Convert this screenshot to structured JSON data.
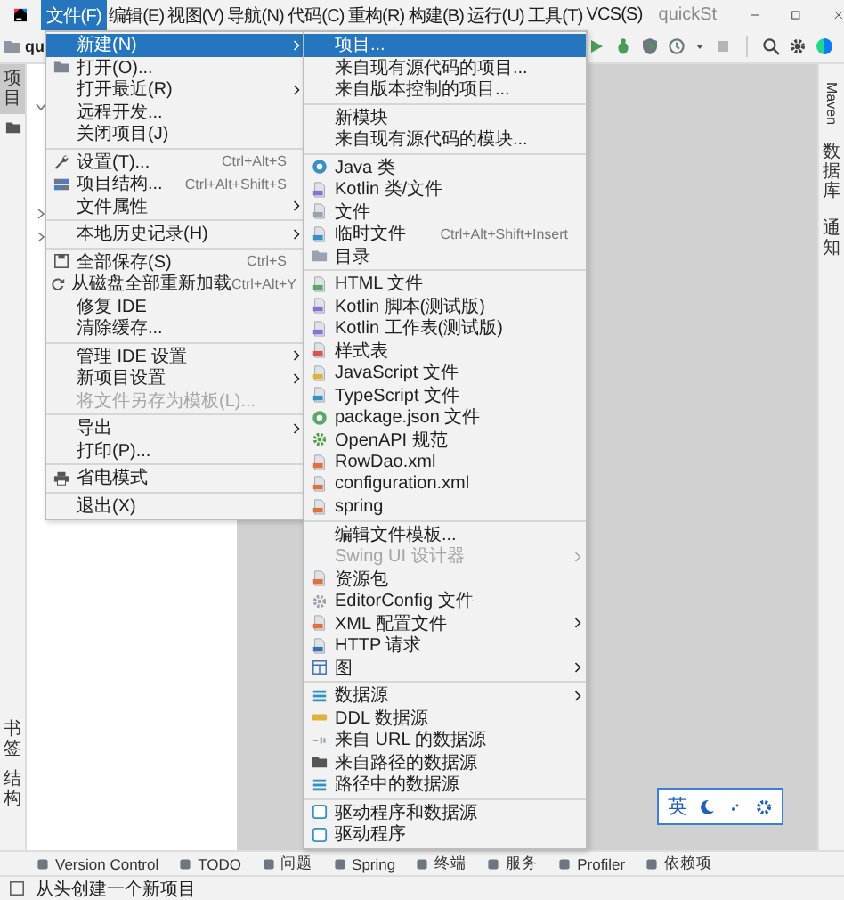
{
  "window": {
    "title": "quickSt"
  },
  "menu_bar": [
    {
      "label": "文件(F)",
      "selected": true
    },
    {
      "label": "编辑(E)",
      "selected": false
    },
    {
      "label": "视图(V)",
      "selected": false
    },
    {
      "label": "导航(N)",
      "selected": false
    },
    {
      "label": "代码(C)",
      "selected": false
    },
    {
      "label": "重构(R)",
      "selected": false
    },
    {
      "label": "构建(B)",
      "selected": false
    },
    {
      "label": "运行(U)",
      "selected": false
    },
    {
      "label": "工具(T)",
      "selected": false
    },
    {
      "label": "VCS(S)",
      "selected": false
    }
  ],
  "toolbar": {
    "project": "qu"
  },
  "left_stripe": {
    "top": [
      {
        "label": "项目",
        "selected": true
      }
    ],
    "bottom": [
      {
        "label": "书签",
        "selected": false
      },
      {
        "label": "结构",
        "selected": false
      }
    ]
  },
  "right_stripe": [
    {
      "label": "Maven"
    },
    {
      "label": "数据库"
    },
    {
      "label": "通知"
    }
  ],
  "file_menu": [
    [
      {
        "label": "新建(N)",
        "selected": true,
        "disabled": false,
        "submenu": true
      },
      {
        "label": "打开(O)...",
        "selected": false,
        "disabled": false,
        "submenu": false
      },
      {
        "label": "打开最近(R)",
        "selected": false,
        "disabled": false,
        "submenu": true
      },
      {
        "label": "远程开发...",
        "selected": false,
        "disabled": false,
        "submenu": false
      },
      {
        "label": "关闭项目(J)",
        "selected": false,
        "disabled": false,
        "submenu": false
      }
    ],
    [
      {
        "label": "设置(T)...",
        "shortcut": "Ctrl+Alt+S",
        "selected": false,
        "disabled": false,
        "submenu": false
      },
      {
        "label": "项目结构...",
        "shortcut": "Ctrl+Alt+Shift+S",
        "selected": false,
        "disabled": false,
        "submenu": false
      },
      {
        "label": "文件属性",
        "selected": false,
        "disabled": false,
        "submenu": true
      }
    ],
    [
      {
        "label": "本地历史记录(H)",
        "selected": false,
        "disabled": false,
        "submenu": true
      }
    ],
    [
      {
        "label": "全部保存(S)",
        "shortcut": "Ctrl+S",
        "selected": false,
        "disabled": false,
        "submenu": false
      },
      {
        "label": "从磁盘全部重新加载",
        "shortcut": "Ctrl+Alt+Y",
        "selected": false,
        "disabled": false,
        "submenu": false
      },
      {
        "label": "修复 IDE",
        "selected": false,
        "disabled": false,
        "submenu": false
      },
      {
        "label": "清除缓存...",
        "selected": false,
        "disabled": false,
        "submenu": false
      }
    ],
    [
      {
        "label": "管理 IDE 设置",
        "selected": false,
        "disabled": false,
        "submenu": true
      },
      {
        "label": "新项目设置",
        "selected": false,
        "disabled": false,
        "submenu": true
      },
      {
        "label": "将文件另存为模板(L)...",
        "selected": false,
        "disabled": true,
        "submenu": false
      }
    ],
    [
      {
        "label": "导出",
        "selected": false,
        "disabled": false,
        "submenu": true
      },
      {
        "label": "打印(P)...",
        "selected": false,
        "disabled": false,
        "submenu": false
      }
    ],
    [
      {
        "label": "省电模式",
        "selected": false,
        "disabled": false,
        "submenu": false
      }
    ],
    [
      {
        "label": "退出(X)",
        "selected": false,
        "disabled": false,
        "submenu": false
      }
    ]
  ],
  "new_submenu": [
    [
      {
        "label": "项目...",
        "selected": true,
        "disabled": false,
        "submenu": false
      },
      {
        "label": "来自现有源代码的项目...",
        "selected": false,
        "disabled": false,
        "submenu": false
      },
      {
        "label": "来自版本控制的项目...",
        "selected": false,
        "disabled": false,
        "submenu": false
      }
    ],
    [
      {
        "label": "新模块",
        "selected": false,
        "disabled": false,
        "submenu": false
      },
      {
        "label": "来自现有源代码的模块...",
        "selected": false,
        "disabled": false,
        "submenu": false
      }
    ],
    [
      {
        "label": "Java 类",
        "selected": false,
        "disabled": false,
        "submenu": false
      },
      {
        "label": "Kotlin 类/文件",
        "selected": false,
        "disabled": false,
        "submenu": false
      },
      {
        "label": "文件",
        "selected": false,
        "disabled": false,
        "submenu": false
      },
      {
        "label": "临时文件",
        "shortcut": "Ctrl+Alt+Shift+Insert",
        "selected": false,
        "disabled": false,
        "submenu": false
      },
      {
        "label": "目录",
        "selected": false,
        "disabled": false,
        "submenu": false
      }
    ],
    [
      {
        "label": "HTML 文件",
        "selected": false,
        "disabled": false,
        "submenu": false
      },
      {
        "label": "Kotlin 脚本(测试版)",
        "selected": false,
        "disabled": false,
        "submenu": false
      },
      {
        "label": "Kotlin 工作表(测试版)",
        "selected": false,
        "disabled": false,
        "submenu": false
      },
      {
        "label": "样式表",
        "selected": false,
        "disabled": false,
        "submenu": false
      },
      {
        "label": "JavaScript 文件",
        "selected": false,
        "disabled": false,
        "submenu": false
      },
      {
        "label": "TypeScript 文件",
        "selected": false,
        "disabled": false,
        "submenu": false
      },
      {
        "label": "package.json 文件",
        "selected": false,
        "disabled": false,
        "submenu": false
      },
      {
        "label": "OpenAPI 规范",
        "selected": false,
        "disabled": false,
        "submenu": false
      },
      {
        "label": "RowDao.xml",
        "selected": false,
        "disabled": false,
        "submenu": false
      },
      {
        "label": "configuration.xml",
        "selected": false,
        "disabled": false,
        "submenu": false
      },
      {
        "label": "spring",
        "selected": false,
        "disabled": false,
        "submenu": false
      }
    ],
    [
      {
        "label": "编辑文件模板...",
        "selected": false,
        "disabled": false,
        "submenu": false
      },
      {
        "label": "Swing UI 设计器",
        "selected": false,
        "disabled": true,
        "submenu": true
      },
      {
        "label": "资源包",
        "selected": false,
        "disabled": false,
        "submenu": false
      },
      {
        "label": "EditorConfig 文件",
        "selected": false,
        "disabled": false,
        "submenu": false
      },
      {
        "label": "XML 配置文件",
        "selected": false,
        "disabled": false,
        "submenu": true
      },
      {
        "label": "HTTP 请求",
        "selected": false,
        "disabled": false,
        "submenu": false
      },
      {
        "label": "图",
        "selected": false,
        "disabled": false,
        "submenu": true
      }
    ],
    [
      {
        "label": "数据源",
        "selected": false,
        "disabled": false,
        "submenu": true
      },
      {
        "label": "DDL 数据源",
        "selected": false,
        "disabled": false,
        "submenu": false
      },
      {
        "label": "来自 URL 的数据源",
        "selected": false,
        "disabled": false,
        "submenu": false
      },
      {
        "label": "来自路径的数据源",
        "selected": false,
        "disabled": false,
        "submenu": false
      },
      {
        "label": "路径中的数据源",
        "selected": false,
        "disabled": false,
        "submenu": false
      }
    ],
    [
      {
        "label": "驱动程序和数据源",
        "selected": false,
        "disabled": false,
        "submenu": false
      },
      {
        "label": "驱动程序",
        "selected": false,
        "disabled": false,
        "submenu": false
      }
    ]
  ],
  "bottom_tabs": [
    {
      "label": "Version Control"
    },
    {
      "label": "TODO"
    },
    {
      "label": "问题"
    },
    {
      "label": "Spring"
    },
    {
      "label": "终端"
    },
    {
      "label": "服务"
    },
    {
      "label": "Profiler"
    },
    {
      "label": "依赖项"
    }
  ],
  "ime_widget": {
    "label": "英"
  },
  "status_bar": {
    "text": "从头创建一个新项目"
  }
}
